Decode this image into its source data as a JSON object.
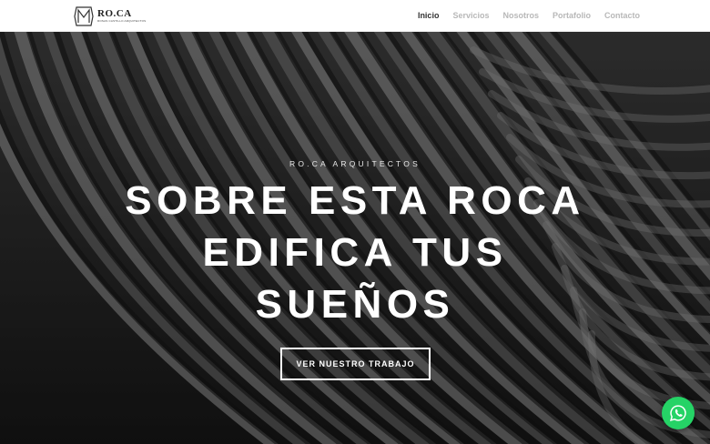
{
  "header": {
    "logo": {
      "title": "RO.CA",
      "subtitle": "ROSAS CASTILLO ARQUITECTOS"
    },
    "nav": [
      {
        "label": "Inicio",
        "active": true
      },
      {
        "label": "Servicios",
        "active": false
      },
      {
        "label": "Nosotros",
        "active": false
      },
      {
        "label": "Portafolio",
        "active": false
      },
      {
        "label": "Contacto",
        "active": false
      }
    ]
  },
  "hero": {
    "eyebrow": "RO.CA ARQUITECTOS",
    "headline_lines": [
      "SOBRE ESTA ROCA",
      "EDIFICA TUS",
      "SUEÑOS"
    ],
    "cta_label": "VER NUESTRO TRABAJO"
  },
  "floating": {
    "icon": "whatsapp-icon",
    "color": "#25d366"
  },
  "colors": {
    "nav_active": "#333333",
    "nav_inactive": "#b8b8b8"
  }
}
